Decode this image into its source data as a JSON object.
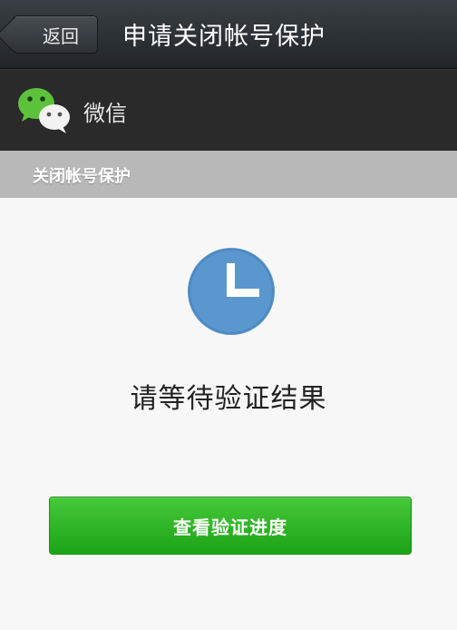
{
  "header": {
    "back_label": "返回",
    "title": "申请关闭帐号保护"
  },
  "app": {
    "name": "微信",
    "icon": "wechat-logo-icon"
  },
  "section": {
    "title": "关闭帐号保护"
  },
  "status": {
    "icon": "clock-icon",
    "message": "请等待验证结果"
  },
  "actions": {
    "check_progress_label": "查看验证进度"
  },
  "colors": {
    "primary_button": "#2bb324",
    "clock": "#5a97cf",
    "titlebar": "#2d3135",
    "section_bar": "#b8b8b8"
  }
}
